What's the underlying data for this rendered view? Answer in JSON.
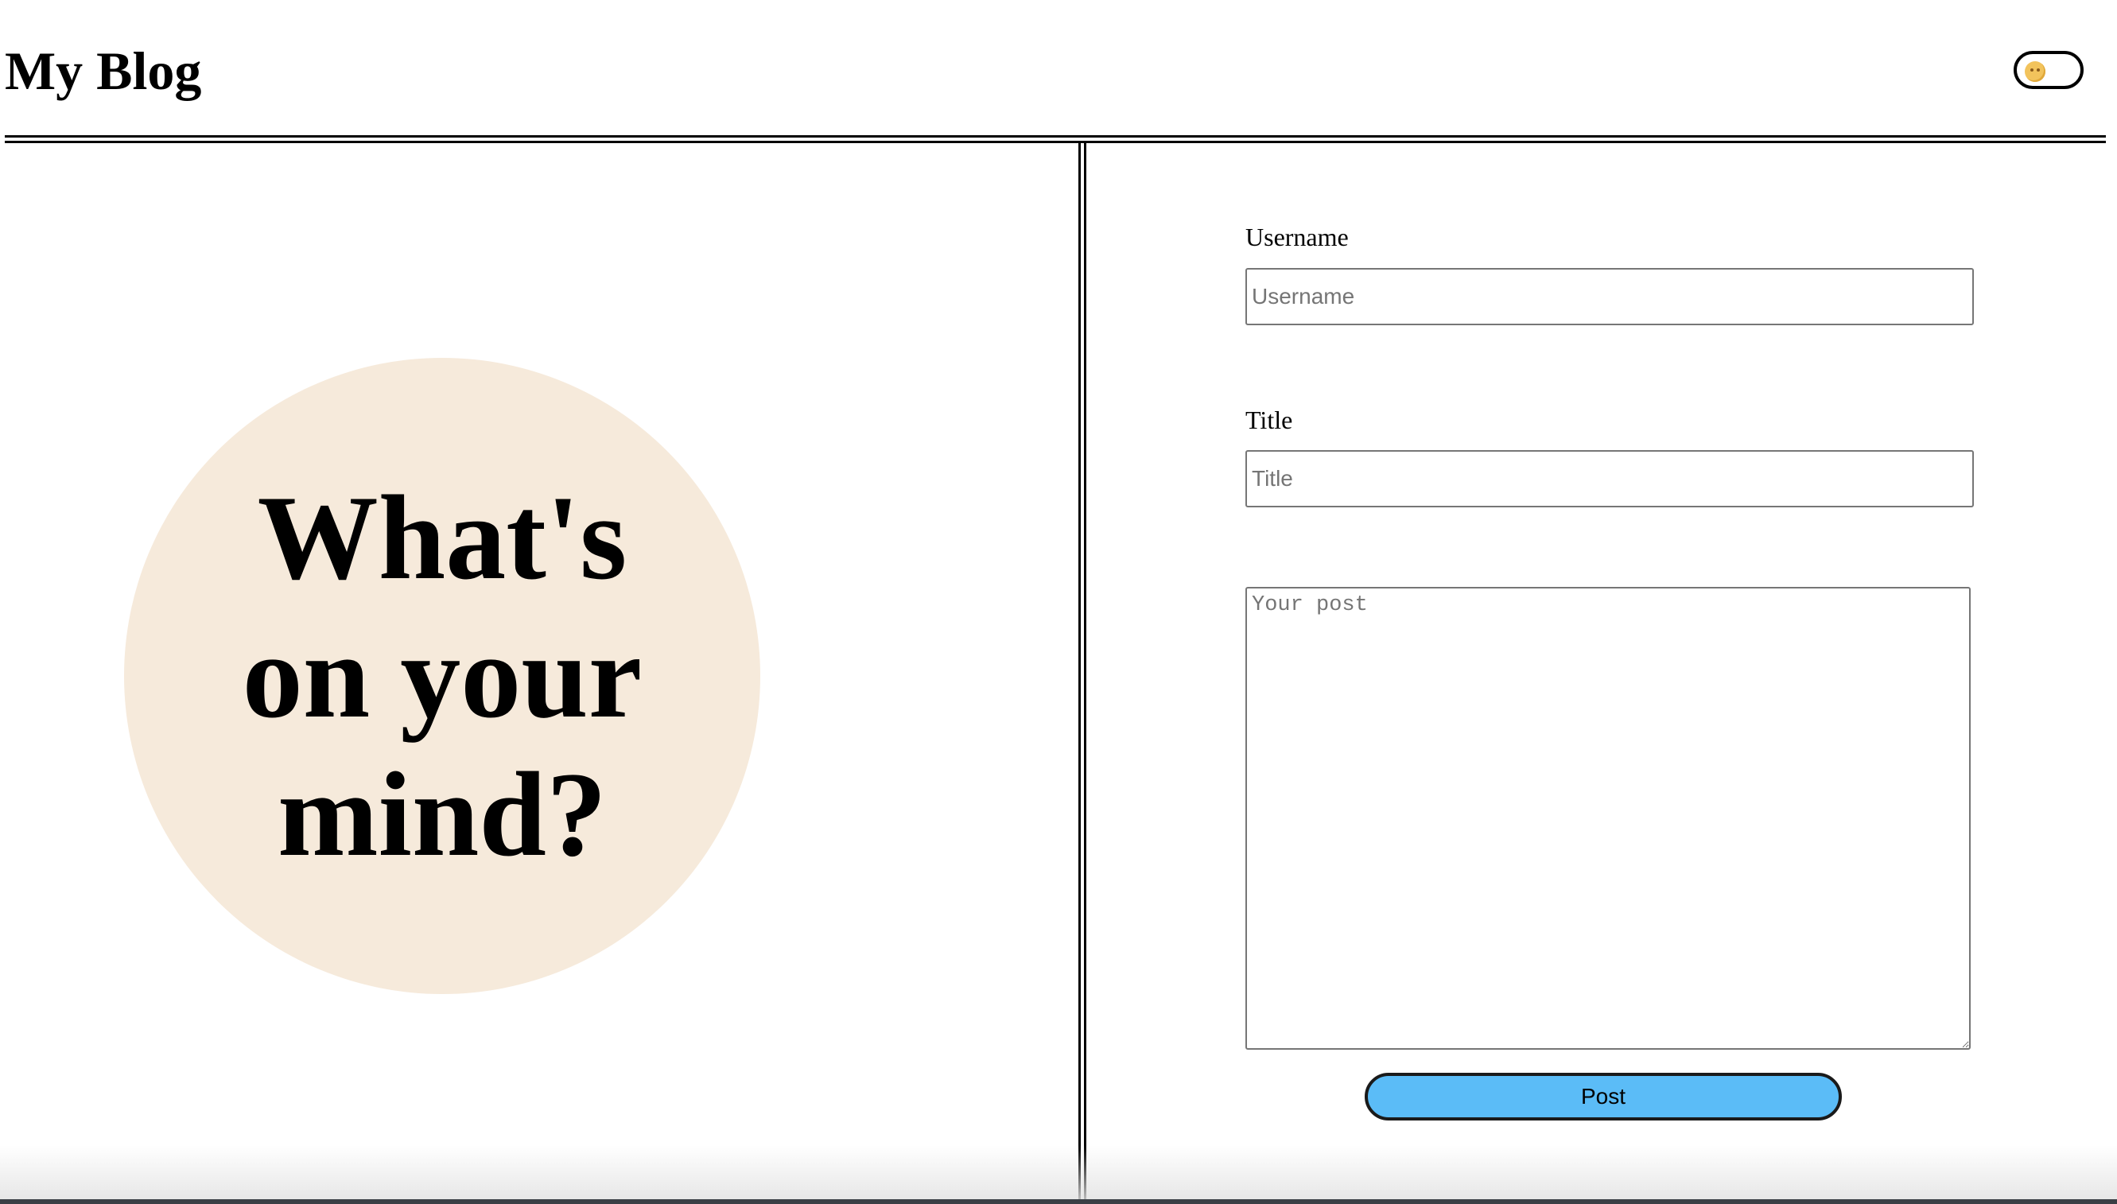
{
  "header": {
    "title": "My Blog",
    "theme_toggle_icon": "smiley-face-icon"
  },
  "hero": {
    "text": "What's on your mind?",
    "circle_color": "#f6eadb"
  },
  "form": {
    "username_label": "Username",
    "username_placeholder": "Username",
    "username_value": "",
    "title_label": "Title",
    "title_placeholder": "Title",
    "title_value": "",
    "post_placeholder": "Your post",
    "post_value": "",
    "submit_label": "Post",
    "submit_color": "#5bbcf7"
  }
}
